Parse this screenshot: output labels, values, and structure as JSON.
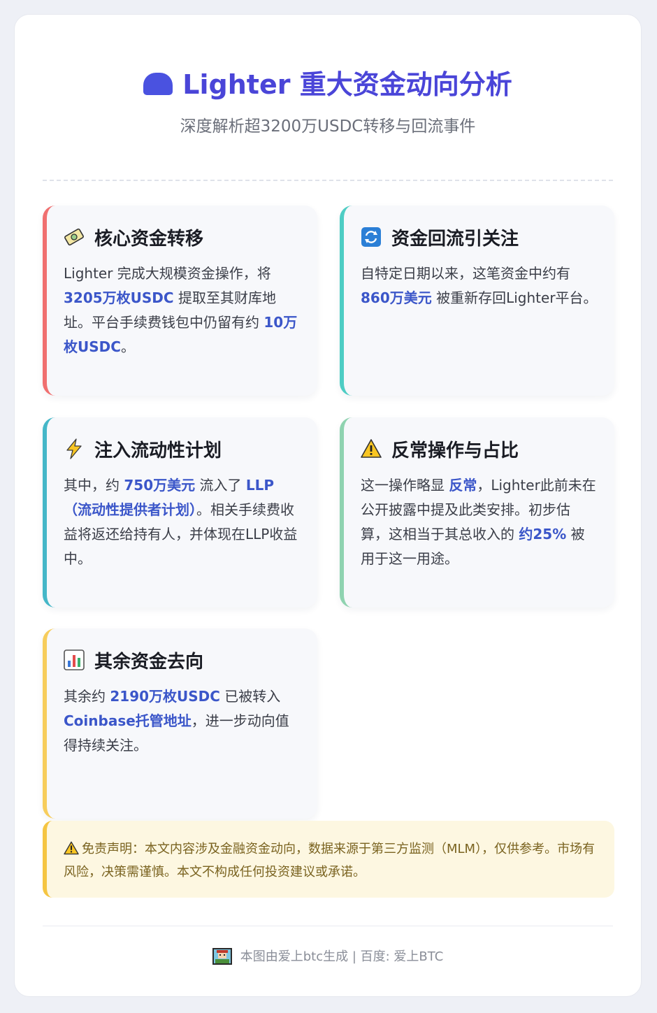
{
  "header": {
    "title": "Lighter 重大资金动向分析",
    "title_icon": "hat-icon",
    "subtitle": "深度解析超3200万USDC转移与回流事件"
  },
  "cards": {
    "core": {
      "icon": "money-icon",
      "title": "核心资金转移",
      "p1": "Lighter 完成大规模资金操作，将 ",
      "h1": "3205万枚USDC",
      "p2": " 提取至其财库地址。平台手续费钱包中仍留有约 ",
      "h2": "10万枚USDC",
      "p3": "。"
    },
    "return": {
      "icon": "refresh-icon",
      "title": "资金回流引关注",
      "p1": "自特定日期以来，这笔资金中约有 ",
      "h1": "860万美元",
      "p2": " 被重新存回Lighter平台。"
    },
    "liquidity": {
      "icon": "lightning-icon",
      "title": "注入流动性计划",
      "p1": "其中，约 ",
      "h1": "750万美元",
      "p2": " 流入了 ",
      "h2": "LLP（流动性提供者计划）",
      "p3": "。相关手续费收益将返还给持有人，并体现在LLP收益中。"
    },
    "unusual": {
      "icon": "warning-icon",
      "title": "反常操作与占比",
      "p1": "这一操作略显 ",
      "h1": "反常",
      "p2": "，Lighter此前未在公开披露中提及此类安排。初步估算，这相当于其总收入的 ",
      "h2": "约25%",
      "p3": " 被用于这一用途。"
    },
    "rest": {
      "icon": "bar-chart-icon",
      "title": "其余资金去向",
      "p1": "其余约 ",
      "h1": "2190万枚USDC",
      "p2": " 已被转入 ",
      "h2": "Coinbase托管地址",
      "p3": "，进一步动向值得持续关注。"
    }
  },
  "disclaimer": {
    "icon": "warning-icon",
    "text": "免责声明：本文内容涉及金融资金动向，数据来源于第三方监测（MLM），仅供参考。市场有风险，决策需谨慎。本文不构成任何投资建议或承诺。"
  },
  "footer": {
    "icon": "pixel-avatar-icon",
    "text": "本图由爱上btc生成 | 百度: 爱上BTC"
  },
  "colors": {
    "accent": "#4a45d8",
    "highlight": "#3b56c9",
    "card_core_border": "#f07070",
    "card_return_border": "#4ecdc4",
    "card_liquidity_border": "#45b7c8",
    "card_unusual_border": "#8fd3b0",
    "card_rest_border": "#f7cd5c",
    "disclaimer_bg": "#fdf7e1"
  }
}
